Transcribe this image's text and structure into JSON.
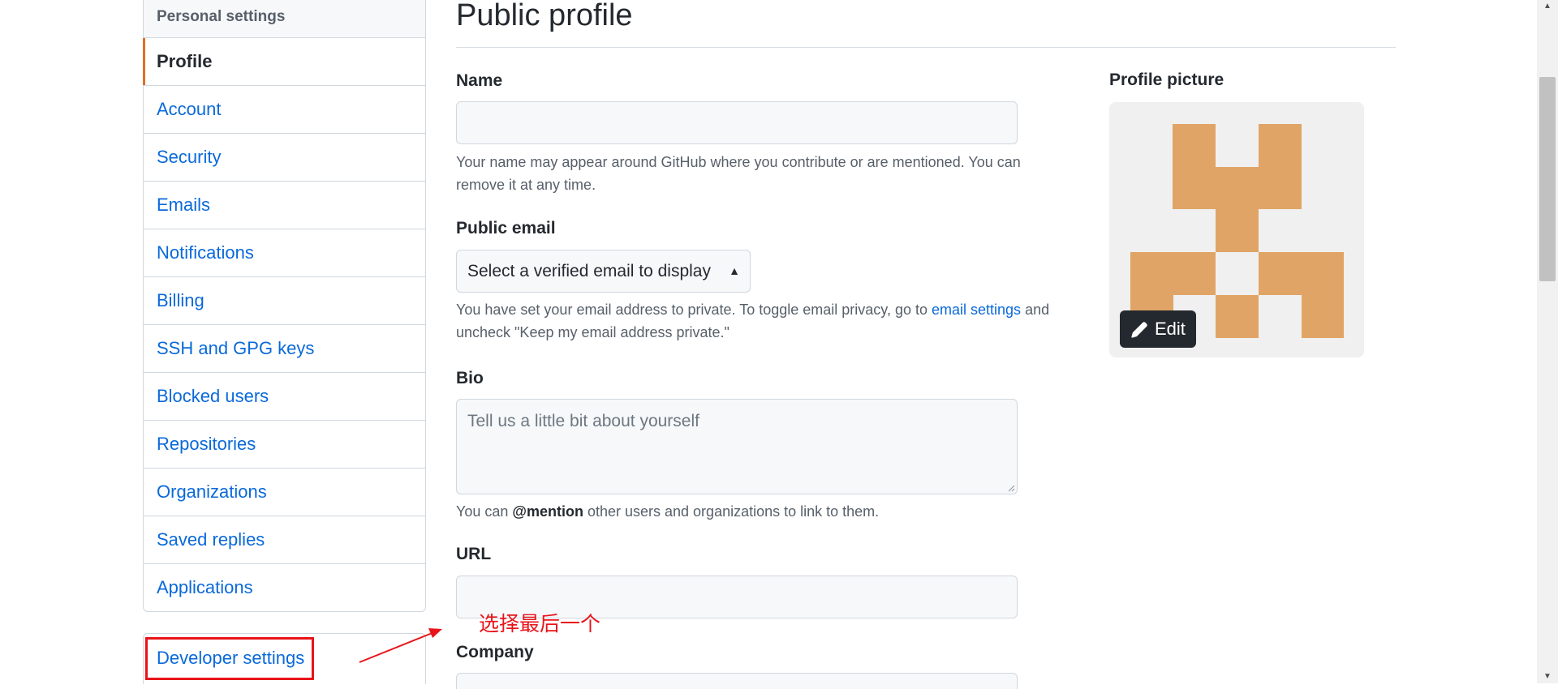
{
  "sidebar": {
    "header": "Personal settings",
    "items": [
      {
        "label": "Profile",
        "active": true
      },
      {
        "label": "Account"
      },
      {
        "label": "Security"
      },
      {
        "label": "Emails"
      },
      {
        "label": "Notifications"
      },
      {
        "label": "Billing"
      },
      {
        "label": "SSH and GPG keys"
      },
      {
        "label": "Blocked users"
      },
      {
        "label": "Repositories"
      },
      {
        "label": "Organizations"
      },
      {
        "label": "Saved replies"
      },
      {
        "label": "Applications"
      }
    ],
    "developer_settings": "Developer settings"
  },
  "main": {
    "title": "Public profile",
    "name": {
      "label": "Name",
      "value": "",
      "note": "Your name may appear around GitHub where you contribute or are mentioned. You can remove it at any time."
    },
    "public_email": {
      "label": "Public email",
      "selected": "Select a verified email to display",
      "note_before": "You have set your email address to private. To toggle email privacy, go to ",
      "note_link": "email settings",
      "note_after": " and uncheck \"Keep my email address private.\""
    },
    "bio": {
      "label": "Bio",
      "placeholder": "Tell us a little bit about yourself",
      "note_before": "You can ",
      "note_bold": "@mention",
      "note_after": " other users and organizations to link to them."
    },
    "url": {
      "label": "URL",
      "value": ""
    },
    "company": {
      "label": "Company"
    }
  },
  "profile_picture": {
    "label": "Profile picture",
    "edit_label": "Edit",
    "avatar_color": "#e0a566"
  },
  "annotation": {
    "text": "选择最后一个",
    "color": "#e8141a"
  },
  "colors": {
    "link": "#0969da",
    "active_indicator": "#e16f24"
  }
}
